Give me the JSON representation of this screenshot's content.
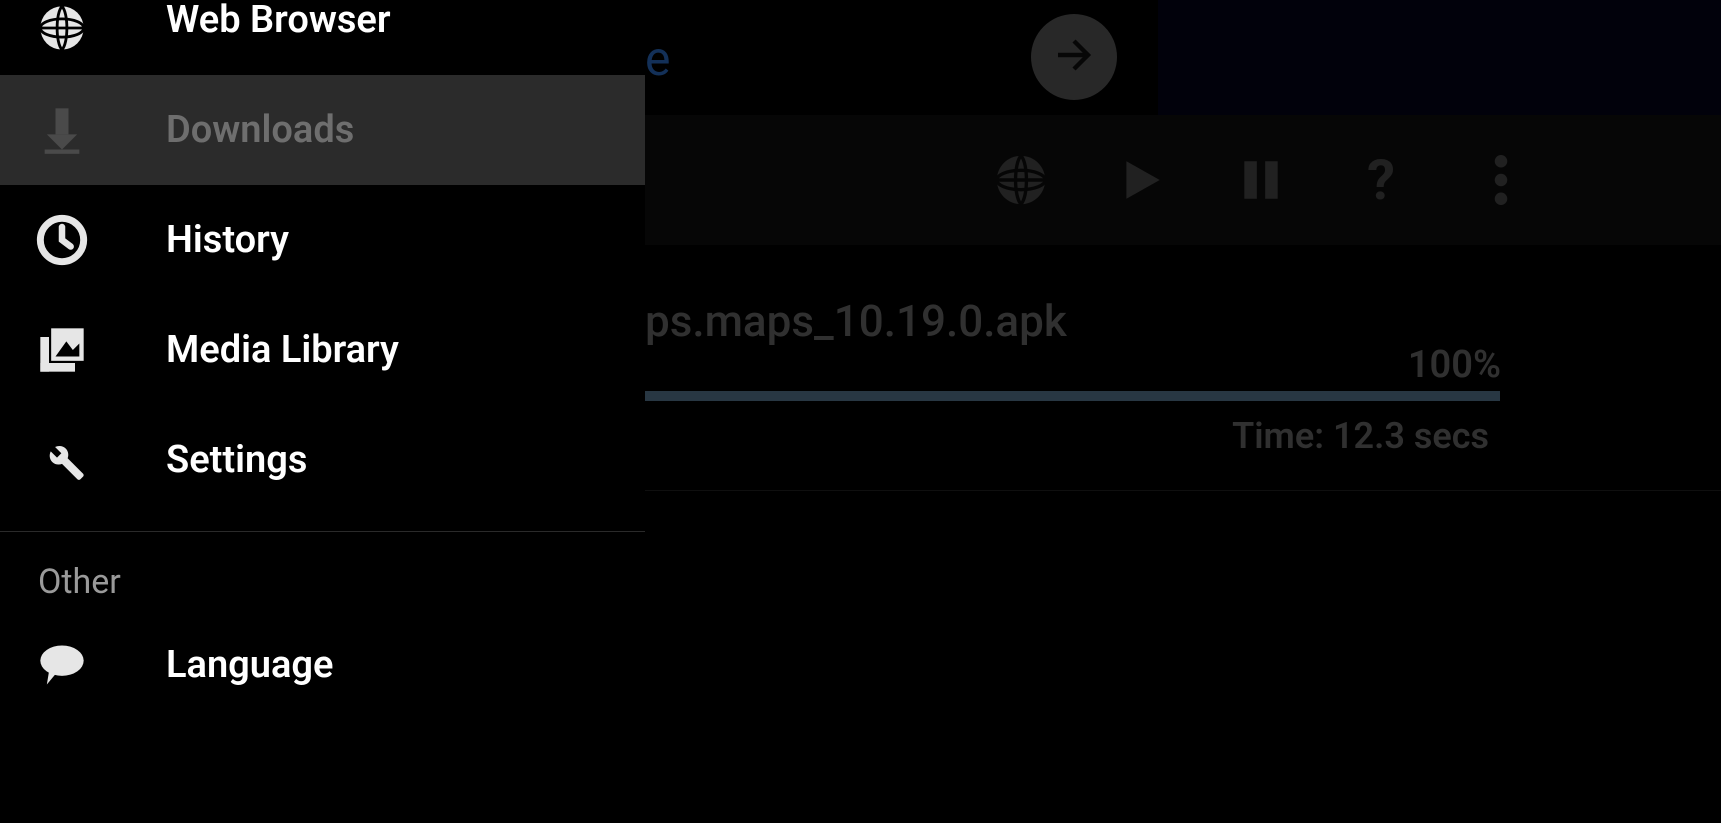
{
  "url_fragment_visible": "e",
  "toolbar_icons": {
    "globe": "globe-icon",
    "play": "play-icon",
    "pause": "pause-icon",
    "help_symbol": "?",
    "more": "more-vert-icon"
  },
  "download_item": {
    "filename_visible_fragment": "ps.maps_10.19.0.apk",
    "percent_label": "100%",
    "time_label": "Time: 12.3 secs"
  },
  "drawer": {
    "items": [
      {
        "label": "Web Browser",
        "icon": "globe-icon",
        "selected": false
      },
      {
        "label": "Downloads",
        "icon": "download-icon",
        "selected": true
      },
      {
        "label": "History",
        "icon": "clock-icon",
        "selected": false
      },
      {
        "label": "Media Library",
        "icon": "photo-library-icon",
        "selected": false
      },
      {
        "label": "Settings",
        "icon": "wrench-icon",
        "selected": false
      }
    ],
    "section_other": "Other",
    "other_items": [
      {
        "label": "Language",
        "icon": "chat-icon",
        "selected": false
      }
    ]
  }
}
